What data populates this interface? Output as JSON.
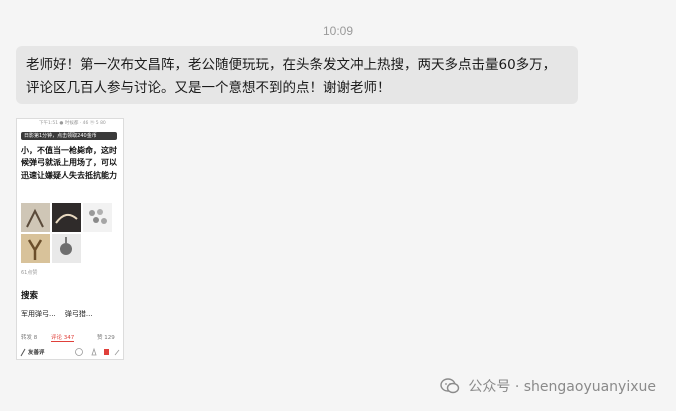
{
  "timestamp": "10:09",
  "message": {
    "text": "老师好！第一次布文昌阵，老公随便玩玩，在头条发文冲上热搜，两天多点击量60多万，评论区几百人参与讨论。又是一个意想不到的点！谢谢老师！"
  },
  "screenshot": {
    "top_line": "下午1:51 ● 时候都 · 46 ⓜ 5 80",
    "banner": "日影第1分钟，点击领取240金币",
    "body_text": "小，不值当一枪毙命，这时候弹弓就派上用场了，可以迅速让嫌疑人失去抵抗能力",
    "caption": "61点赞",
    "search_heading": "搜索",
    "related": [
      "军用弹弓...",
      "弹弓猎..."
    ],
    "tabs": [
      "转发 8",
      "评论 347",
      "赞 129"
    ],
    "bottom_user": "友善评"
  },
  "watermark": {
    "label": "公众号 · shengaoyuanyixue"
  }
}
